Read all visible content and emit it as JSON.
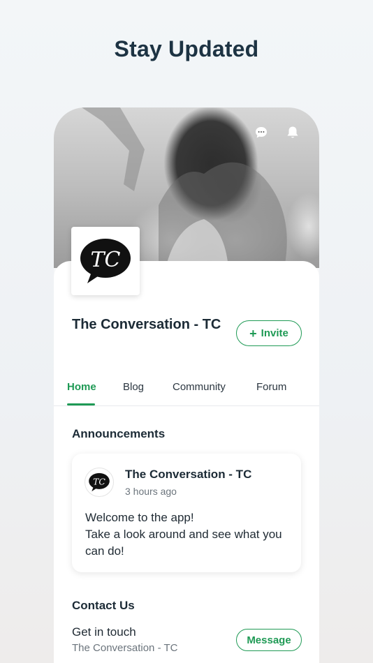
{
  "headline": "Stay Updated",
  "header": {
    "icons": [
      "chat-icon",
      "bell-icon"
    ]
  },
  "site": {
    "logo_text": "TC",
    "title": "The Conversation - TC",
    "invite_label": "Invite"
  },
  "tabs": [
    {
      "label": "Home",
      "active": true
    },
    {
      "label": "Blog",
      "active": false
    },
    {
      "label": "Community",
      "active": false
    },
    {
      "label": "Forum",
      "active": false
    }
  ],
  "announcements": {
    "title": "Announcements",
    "post": {
      "author": "The Conversation - TC",
      "time": "3 hours ago",
      "lines": [
        "Welcome to the app!",
        "Take a look around and see what you",
        "can do!"
      ]
    }
  },
  "contact": {
    "title": "Contact Us",
    "label": "Get in touch",
    "sub": "The Conversation - TC",
    "button_label": "Message"
  },
  "colors": {
    "accent": "#1f9a55",
    "text": "#1c2b36",
    "headline": "#1d3343"
  }
}
